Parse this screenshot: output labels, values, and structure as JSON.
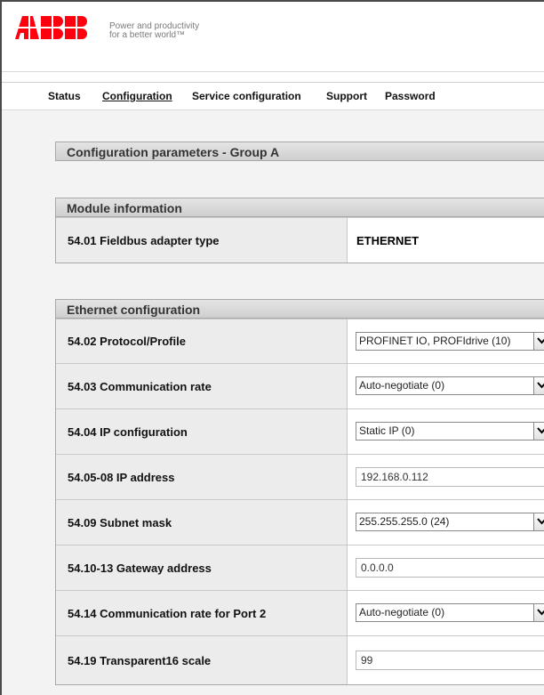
{
  "header": {
    "logo_text": "ABB",
    "tagline_line1": "Power and productivity",
    "tagline_line2": "for a better world™"
  },
  "nav": {
    "items": [
      {
        "label": "Status",
        "active": false
      },
      {
        "label": "Configuration",
        "active": true
      },
      {
        "label": "Service configuration",
        "active": false
      },
      {
        "label": "Support",
        "active": false
      },
      {
        "label": "Password",
        "active": false
      }
    ]
  },
  "page_title": "Configuration parameters - Group A",
  "module_info": {
    "title": "Module information",
    "rows": [
      {
        "label": "54.01 Fieldbus adapter type",
        "value": "ETHERNET"
      }
    ]
  },
  "ethernet_config": {
    "title": "Ethernet configuration",
    "rows": [
      {
        "label": "54.02 Protocol/Profile",
        "control": "select",
        "value": "PROFINET IO, PROFIdrive (10)"
      },
      {
        "label": "54.03 Communication rate",
        "control": "select",
        "value": "Auto-negotiate (0)"
      },
      {
        "label": "54.04 IP configuration",
        "control": "select",
        "value": "Static IP (0)"
      },
      {
        "label": "54.05-08 IP address",
        "control": "text",
        "value": "192.168.0.112"
      },
      {
        "label": "54.09 Subnet mask",
        "control": "select",
        "value": "255.255.255.0 (24)"
      },
      {
        "label": "54.10-13 Gateway address",
        "control": "text",
        "value": "0.0.0.0"
      },
      {
        "label": "54.14 Communication rate for Port 2",
        "control": "select",
        "value": "Auto-negotiate (0)"
      },
      {
        "label": "54.19 Transparent16 scale",
        "control": "text",
        "value": "99"
      }
    ]
  },
  "colors": {
    "brand_red": "#ff000f",
    "section_header_bg": "#d9d9d9",
    "label_bg": "#ececec"
  },
  "icons": {
    "dropdown_arrow": "chevron-down-icon"
  }
}
